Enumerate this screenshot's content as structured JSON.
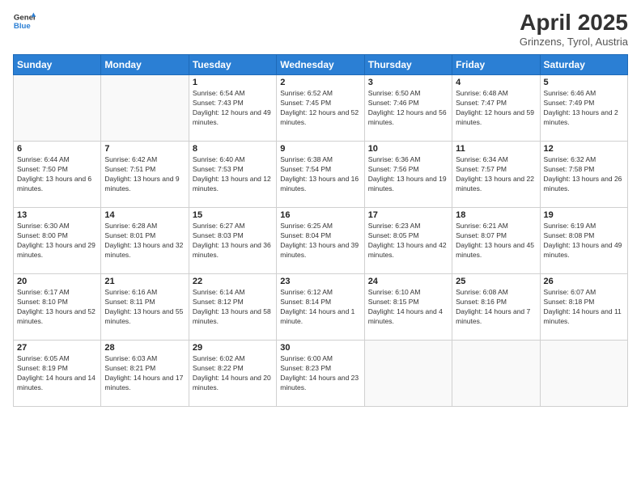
{
  "logo": {
    "line1": "General",
    "line2": "Blue"
  },
  "title": "April 2025",
  "subtitle": "Grinzens, Tyrol, Austria",
  "weekdays": [
    "Sunday",
    "Monday",
    "Tuesday",
    "Wednesday",
    "Thursday",
    "Friday",
    "Saturday"
  ],
  "weeks": [
    [
      {
        "day": "",
        "info": ""
      },
      {
        "day": "",
        "info": ""
      },
      {
        "day": "1",
        "info": "Sunrise: 6:54 AM\nSunset: 7:43 PM\nDaylight: 12 hours and 49 minutes."
      },
      {
        "day": "2",
        "info": "Sunrise: 6:52 AM\nSunset: 7:45 PM\nDaylight: 12 hours and 52 minutes."
      },
      {
        "day": "3",
        "info": "Sunrise: 6:50 AM\nSunset: 7:46 PM\nDaylight: 12 hours and 56 minutes."
      },
      {
        "day": "4",
        "info": "Sunrise: 6:48 AM\nSunset: 7:47 PM\nDaylight: 12 hours and 59 minutes."
      },
      {
        "day": "5",
        "info": "Sunrise: 6:46 AM\nSunset: 7:49 PM\nDaylight: 13 hours and 2 minutes."
      }
    ],
    [
      {
        "day": "6",
        "info": "Sunrise: 6:44 AM\nSunset: 7:50 PM\nDaylight: 13 hours and 6 minutes."
      },
      {
        "day": "7",
        "info": "Sunrise: 6:42 AM\nSunset: 7:51 PM\nDaylight: 13 hours and 9 minutes."
      },
      {
        "day": "8",
        "info": "Sunrise: 6:40 AM\nSunset: 7:53 PM\nDaylight: 13 hours and 12 minutes."
      },
      {
        "day": "9",
        "info": "Sunrise: 6:38 AM\nSunset: 7:54 PM\nDaylight: 13 hours and 16 minutes."
      },
      {
        "day": "10",
        "info": "Sunrise: 6:36 AM\nSunset: 7:56 PM\nDaylight: 13 hours and 19 minutes."
      },
      {
        "day": "11",
        "info": "Sunrise: 6:34 AM\nSunset: 7:57 PM\nDaylight: 13 hours and 22 minutes."
      },
      {
        "day": "12",
        "info": "Sunrise: 6:32 AM\nSunset: 7:58 PM\nDaylight: 13 hours and 26 minutes."
      }
    ],
    [
      {
        "day": "13",
        "info": "Sunrise: 6:30 AM\nSunset: 8:00 PM\nDaylight: 13 hours and 29 minutes."
      },
      {
        "day": "14",
        "info": "Sunrise: 6:28 AM\nSunset: 8:01 PM\nDaylight: 13 hours and 32 minutes."
      },
      {
        "day": "15",
        "info": "Sunrise: 6:27 AM\nSunset: 8:03 PM\nDaylight: 13 hours and 36 minutes."
      },
      {
        "day": "16",
        "info": "Sunrise: 6:25 AM\nSunset: 8:04 PM\nDaylight: 13 hours and 39 minutes."
      },
      {
        "day": "17",
        "info": "Sunrise: 6:23 AM\nSunset: 8:05 PM\nDaylight: 13 hours and 42 minutes."
      },
      {
        "day": "18",
        "info": "Sunrise: 6:21 AM\nSunset: 8:07 PM\nDaylight: 13 hours and 45 minutes."
      },
      {
        "day": "19",
        "info": "Sunrise: 6:19 AM\nSunset: 8:08 PM\nDaylight: 13 hours and 49 minutes."
      }
    ],
    [
      {
        "day": "20",
        "info": "Sunrise: 6:17 AM\nSunset: 8:10 PM\nDaylight: 13 hours and 52 minutes."
      },
      {
        "day": "21",
        "info": "Sunrise: 6:16 AM\nSunset: 8:11 PM\nDaylight: 13 hours and 55 minutes."
      },
      {
        "day": "22",
        "info": "Sunrise: 6:14 AM\nSunset: 8:12 PM\nDaylight: 13 hours and 58 minutes."
      },
      {
        "day": "23",
        "info": "Sunrise: 6:12 AM\nSunset: 8:14 PM\nDaylight: 14 hours and 1 minute."
      },
      {
        "day": "24",
        "info": "Sunrise: 6:10 AM\nSunset: 8:15 PM\nDaylight: 14 hours and 4 minutes."
      },
      {
        "day": "25",
        "info": "Sunrise: 6:08 AM\nSunset: 8:16 PM\nDaylight: 14 hours and 7 minutes."
      },
      {
        "day": "26",
        "info": "Sunrise: 6:07 AM\nSunset: 8:18 PM\nDaylight: 14 hours and 11 minutes."
      }
    ],
    [
      {
        "day": "27",
        "info": "Sunrise: 6:05 AM\nSunset: 8:19 PM\nDaylight: 14 hours and 14 minutes."
      },
      {
        "day": "28",
        "info": "Sunrise: 6:03 AM\nSunset: 8:21 PM\nDaylight: 14 hours and 17 minutes."
      },
      {
        "day": "29",
        "info": "Sunrise: 6:02 AM\nSunset: 8:22 PM\nDaylight: 14 hours and 20 minutes."
      },
      {
        "day": "30",
        "info": "Sunrise: 6:00 AM\nSunset: 8:23 PM\nDaylight: 14 hours and 23 minutes."
      },
      {
        "day": "",
        "info": ""
      },
      {
        "day": "",
        "info": ""
      },
      {
        "day": "",
        "info": ""
      }
    ]
  ]
}
